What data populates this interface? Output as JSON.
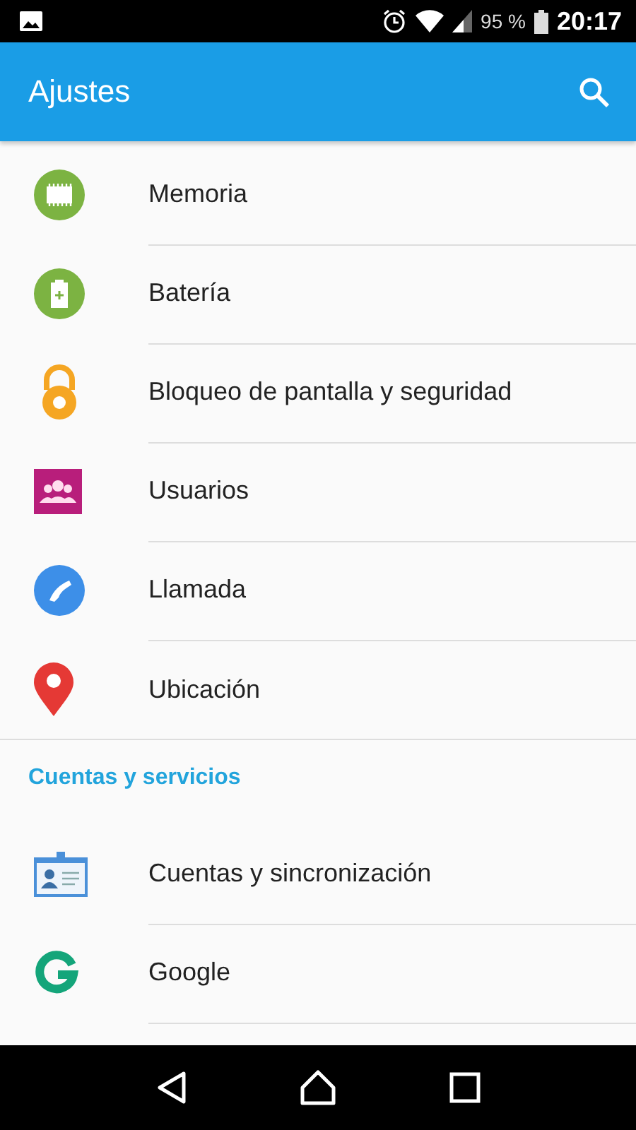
{
  "status_bar": {
    "battery": "95 %",
    "time": "20:17"
  },
  "app_bar": {
    "title": "Ajustes"
  },
  "sections": [
    {
      "items": [
        {
          "kind": "memory",
          "label": "Memoria"
        },
        {
          "kind": "battery",
          "label": "Batería"
        },
        {
          "kind": "lock",
          "label": "Bloqueo de pantalla y seguridad"
        },
        {
          "kind": "users",
          "label": "Usuarios"
        },
        {
          "kind": "phone",
          "label": "Llamada"
        },
        {
          "kind": "location",
          "label": "Ubicación"
        }
      ]
    },
    {
      "header": "Cuentas y servicios",
      "items": [
        {
          "kind": "account",
          "label": "Cuentas y sincronización"
        },
        {
          "kind": "google",
          "label": "Google"
        }
      ]
    }
  ]
}
